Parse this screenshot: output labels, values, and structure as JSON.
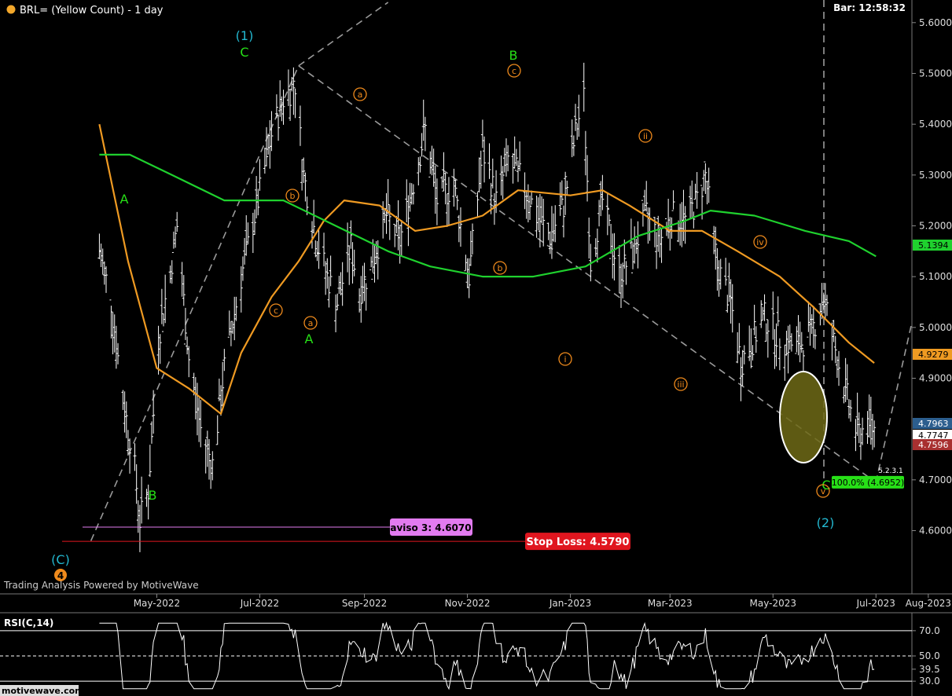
{
  "header": {
    "title": "BRL= (Yellow Count) - 1 day",
    "bar_time": "Bar: 12:58:32",
    "dot_color": "#f2a72b"
  },
  "branding": {
    "powered_by": "Trading Analysis Powered by MotiveWave",
    "logo": "motivewave.com"
  },
  "colors": {
    "bars": "#ffffff",
    "ma_fast": "#ef9a22",
    "ma_slow": "#1fd12e",
    "wave_green": "#27e017",
    "wave_cyan": "#23b7cf",
    "wave_orange": "#ef8a1c",
    "ellipse_fill": "#6e6a16",
    "stop_loss": "#e0161f",
    "aviso": "#e27bf0"
  },
  "chart_data": [
    {
      "type": "ohlc",
      "title": "BRL= (Yellow Count) - 1 day",
      "x_ticks": [
        "May-2022",
        "Jul-2022",
        "Sep-2022",
        "Nov-2022",
        "Jan-2023",
        "Mar-2023",
        "May-2023",
        "Jul-2023",
        "Aug-2023"
      ],
      "y_ticks": [
        "5.6000",
        "5.5000",
        "5.4000",
        "5.3000",
        "5.2000",
        "5.1000",
        "5.0000",
        "4.9000",
        "4.7000",
        "4.6000"
      ],
      "ylim": [
        4.52,
        5.63
      ],
      "price_path": [
        {
          "date": "2022-03-28",
          "price": 5.15
        },
        {
          "date": "2022-04-04",
          "price": 5.05
        },
        {
          "date": "2022-04-11",
          "price": 4.86
        },
        {
          "date": "2022-04-18",
          "price": 4.72
        },
        {
          "date": "2022-04-21",
          "price": 4.62
        },
        {
          "date": "2022-04-26",
          "price": 4.68
        },
        {
          "date": "2022-05-02",
          "price": 4.98
        },
        {
          "date": "2022-05-09",
          "price": 5.11
        },
        {
          "date": "2022-05-13",
          "price": 5.2
        },
        {
          "date": "2022-05-20",
          "price": 4.94
        },
        {
          "date": "2022-05-27",
          "price": 4.8
        },
        {
          "date": "2022-06-03",
          "price": 4.73
        },
        {
          "date": "2022-06-10",
          "price": 4.92
        },
        {
          "date": "2022-06-20",
          "price": 5.1
        },
        {
          "date": "2022-06-30",
          "price": 5.25
        },
        {
          "date": "2022-07-08",
          "price": 5.38
        },
        {
          "date": "2022-07-15",
          "price": 5.45
        },
        {
          "date": "2022-07-22",
          "price": 5.48
        },
        {
          "date": "2022-07-27",
          "price": 5.3
        },
        {
          "date": "2022-08-03",
          "price": 5.18
        },
        {
          "date": "2022-08-10",
          "price": 5.1
        },
        {
          "date": "2022-08-16",
          "price": 5.05
        },
        {
          "date": "2022-08-24",
          "price": 5.16
        },
        {
          "date": "2022-08-29",
          "price": 5.07
        },
        {
          "date": "2022-09-05",
          "price": 5.12
        },
        {
          "date": "2022-09-14",
          "price": 5.22
        },
        {
          "date": "2022-09-22",
          "price": 5.17
        },
        {
          "date": "2022-10-01",
          "price": 5.3
        },
        {
          "date": "2022-10-07",
          "price": 5.39
        },
        {
          "date": "2022-10-14",
          "price": 5.25
        },
        {
          "date": "2022-10-24",
          "price": 5.28
        },
        {
          "date": "2022-11-02",
          "price": 5.1
        },
        {
          "date": "2022-11-10",
          "price": 5.35
        },
        {
          "date": "2022-11-18",
          "price": 5.25
        },
        {
          "date": "2022-11-25",
          "price": 5.33
        },
        {
          "date": "2022-12-05",
          "price": 5.28
        },
        {
          "date": "2022-12-12",
          "price": 5.22
        },
        {
          "date": "2022-12-20",
          "price": 5.18
        },
        {
          "date": "2022-12-28",
          "price": 5.24
        },
        {
          "date": "2023-01-05",
          "price": 5.4
        },
        {
          "date": "2023-01-09",
          "price": 5.45
        },
        {
          "date": "2023-01-13",
          "price": 5.13
        },
        {
          "date": "2023-01-20",
          "price": 5.25
        },
        {
          "date": "2023-01-30",
          "price": 5.1
        },
        {
          "date": "2023-02-07",
          "price": 5.15
        },
        {
          "date": "2023-02-15",
          "price": 5.22
        },
        {
          "date": "2023-02-23",
          "price": 5.17
        },
        {
          "date": "2023-03-02",
          "price": 5.22
        },
        {
          "date": "2023-03-10",
          "price": 5.21
        },
        {
          "date": "2023-03-17",
          "price": 5.25
        },
        {
          "date": "2023-03-22",
          "price": 5.3
        },
        {
          "date": "2023-03-29",
          "price": 5.12
        },
        {
          "date": "2023-04-06",
          "price": 5.05
        },
        {
          "date": "2023-04-12",
          "price": 4.93
        },
        {
          "date": "2023-04-18",
          "price": 4.97
        },
        {
          "date": "2023-04-26",
          "price": 5.02
        },
        {
          "date": "2023-05-05",
          "price": 4.98
        },
        {
          "date": "2023-05-15",
          "price": 4.96
        },
        {
          "date": "2023-05-24",
          "price": 4.99
        },
        {
          "date": "2023-05-31",
          "price": 5.06
        },
        {
          "date": "2023-06-06",
          "price": 4.97
        },
        {
          "date": "2023-06-14",
          "price": 4.86
        },
        {
          "date": "2023-06-20",
          "price": 4.79
        },
        {
          "date": "2023-06-27",
          "price": 4.81
        },
        {
          "date": "2023-06-30",
          "price": 4.8
        }
      ],
      "series": [
        {
          "name": "",
          "color": "#ef9a22",
          "points": [
            {
              "date": "2022-03-28",
              "price": 5.4
            },
            {
              "date": "2022-04-14",
              "price": 5.13
            },
            {
              "date": "2022-05-01",
              "price": 4.92
            },
            {
              "date": "2022-05-20",
              "price": 4.88
            },
            {
              "date": "2022-06-08",
              "price": 4.83
            },
            {
              "date": "2022-06-20",
              "price": 4.95
            },
            {
              "date": "2022-07-08",
              "price": 5.06
            },
            {
              "date": "2022-07-24",
              "price": 5.13
            },
            {
              "date": "2022-08-08",
              "price": 5.21
            },
            {
              "date": "2022-08-20",
              "price": 5.25
            },
            {
              "date": "2022-09-10",
              "price": 5.24
            },
            {
              "date": "2022-10-01",
              "price": 5.19
            },
            {
              "date": "2022-10-20",
              "price": 5.2
            },
            {
              "date": "2022-11-10",
              "price": 5.22
            },
            {
              "date": "2022-12-01",
              "price": 5.27
            },
            {
              "date": "2023-01-01",
              "price": 5.26
            },
            {
              "date": "2023-01-20",
              "price": 5.27
            },
            {
              "date": "2023-02-05",
              "price": 5.24
            },
            {
              "date": "2023-03-01",
              "price": 5.19
            },
            {
              "date": "2023-03-20",
              "price": 5.19
            },
            {
              "date": "2023-04-10",
              "price": 5.15
            },
            {
              "date": "2023-05-05",
              "price": 5.1
            },
            {
              "date": "2023-05-25",
              "price": 5.04
            },
            {
              "date": "2023-06-15",
              "price": 4.97
            },
            {
              "date": "2023-06-30",
              "price": 4.93
            }
          ]
        },
        {
          "name": "",
          "color": "#1fd12e",
          "points": [
            {
              "date": "2022-03-28",
              "price": 5.34
            },
            {
              "date": "2022-04-15",
              "price": 5.34
            },
            {
              "date": "2022-05-10",
              "price": 5.3
            },
            {
              "date": "2022-06-10",
              "price": 5.25
            },
            {
              "date": "2022-07-15",
              "price": 5.25
            },
            {
              "date": "2022-08-15",
              "price": 5.2
            },
            {
              "date": "2022-09-15",
              "price": 5.15
            },
            {
              "date": "2022-10-10",
              "price": 5.12
            },
            {
              "date": "2022-11-10",
              "price": 5.1
            },
            {
              "date": "2022-12-10",
              "price": 5.1
            },
            {
              "date": "2023-01-10",
              "price": 5.12
            },
            {
              "date": "2023-02-10",
              "price": 5.18
            },
            {
              "date": "2023-03-10",
              "price": 5.21
            },
            {
              "date": "2023-03-25",
              "price": 5.23
            },
            {
              "date": "2023-04-20",
              "price": 5.22
            },
            {
              "date": "2023-05-20",
              "price": 5.19
            },
            {
              "date": "2023-06-15",
              "price": 5.17
            },
            {
              "date": "2023-07-01",
              "price": 5.14
            }
          ]
        }
      ],
      "wave_labels": [
        {
          "text": "(1)",
          "style": "cyan"
        },
        {
          "text": "C",
          "style": "green"
        },
        {
          "text": "A",
          "style": "green"
        },
        {
          "text": "B",
          "style": "green"
        },
        {
          "text": "B",
          "style": "green"
        },
        {
          "text": "A",
          "style": "green"
        },
        {
          "text": "C",
          "style": "green"
        },
        {
          "text": "(C)",
          "style": "cyan"
        },
        {
          "text": "4",
          "style": "orange-circle-filled"
        },
        {
          "text": "(2)",
          "style": "cyan"
        },
        {
          "text": "a",
          "style": "orange-circle"
        },
        {
          "text": "b",
          "style": "orange-circle"
        },
        {
          "text": "c",
          "style": "orange-circle"
        },
        {
          "text": "a",
          "style": "orange-circle"
        },
        {
          "text": "b",
          "style": "orange-circle"
        },
        {
          "text": "c",
          "style": "orange-circle"
        },
        {
          "text": "i",
          "style": "orange-circle"
        },
        {
          "text": "ii",
          "style": "orange-circle"
        },
        {
          "text": "iii",
          "style": "orange-circle"
        },
        {
          "text": "iv",
          "style": "orange-circle"
        },
        {
          "text": "v",
          "style": "orange-circle"
        }
      ],
      "price_tags": [
        {
          "text": "5.1394",
          "color": "#1fd12e"
        },
        {
          "text": "4.9279",
          "color": "#ef9a22"
        },
        {
          "text": "4.7963",
          "color": "#2c5e8e"
        },
        {
          "text": "4.7747",
          "color": "#ffffff"
        },
        {
          "text": "4.7596",
          "color": "#a83030"
        }
      ],
      "annotations": {
        "target": "100.0% (4.6952)",
        "aviso": "aviso 3: 4.6070",
        "stop_loss": "Stop Loss: 4.5790",
        "small_note": "5.2.3.1"
      }
    },
    {
      "type": "line",
      "title": "RSI(C,14)",
      "y_ticks": [
        "70.0",
        "50.0",
        "39.5",
        "30.0"
      ],
      "ylim": [
        22,
        78
      ],
      "levels": [
        70,
        50,
        30
      ],
      "last_value": 39.5
    }
  ]
}
